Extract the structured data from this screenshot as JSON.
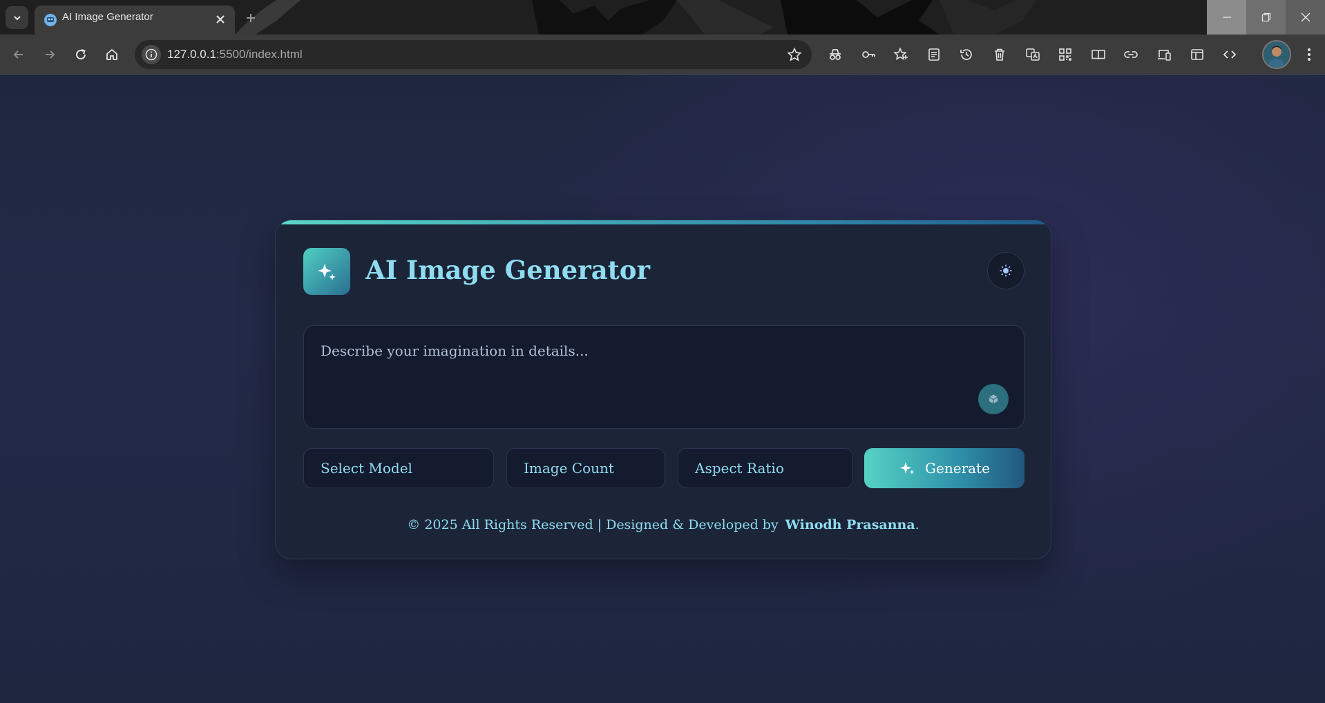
{
  "browser": {
    "tab_title": "AI Image Generator",
    "url_host": "127.0.0.1",
    "url_path": ":5500/index.html"
  },
  "icons": {
    "tab_menu": "chevron-down-icon",
    "tab_close": "close-icon",
    "new_tab": "plus-icon",
    "back": "arrow-left-icon",
    "forward": "arrow-right-icon",
    "reload": "reload-icon",
    "home": "home-icon",
    "site_info": "info-icon",
    "bookmark": "star-icon",
    "extensions": [
      "incognito-icon",
      "key-icon",
      "favorites-icon",
      "reading-list-icon",
      "history-icon",
      "trash-icon",
      "translate-icon",
      "qr-code-icon",
      "reader-mode-icon",
      "link-icon",
      "devices-icon",
      "layout-icon",
      "code-icon"
    ],
    "menu": "kebab-menu-icon"
  },
  "app": {
    "title": "AI Image Generator",
    "prompt_placeholder": "Describe your imagination in details...",
    "model_select": "Select Model",
    "count_select": "Image Count",
    "ratio_select": "Aspect Ratio",
    "generate_label": "Generate",
    "footer_text": "© 2025 All Rights Reserved | Designed & Developed by",
    "footer_author": "Winodh Prasanna",
    "footer_end": "."
  },
  "colors": {
    "accent_start": "#55d3c4",
    "accent_end": "#22577e",
    "title_text": "#8fdcf0",
    "card_bg": "#1c2538",
    "page_bg": "#1f2740"
  }
}
